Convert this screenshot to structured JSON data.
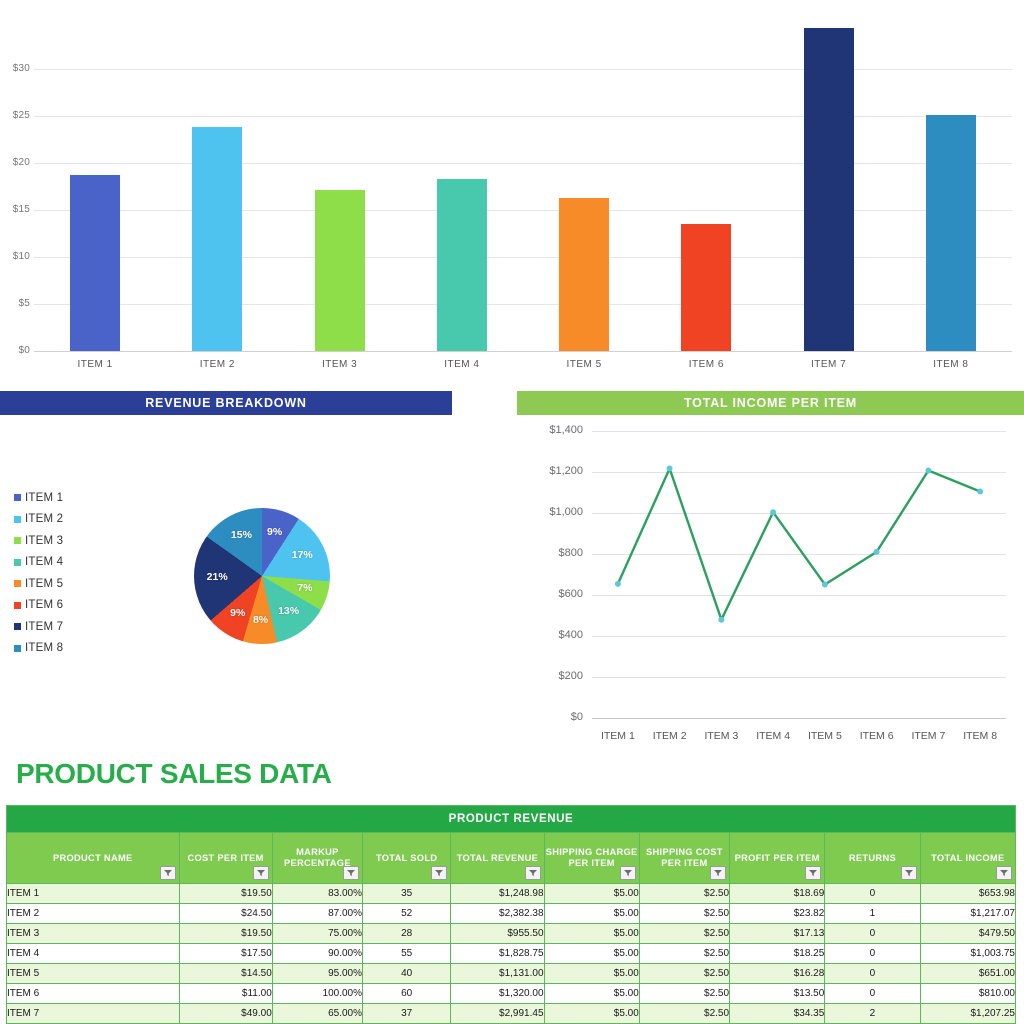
{
  "chart_data": [
    {
      "type": "bar",
      "title": "",
      "xlabel": "",
      "ylabel": "",
      "categories": [
        "ITEM 1",
        "ITEM 2",
        "ITEM 3",
        "ITEM 4",
        "ITEM 5",
        "ITEM 6",
        "ITEM 7",
        "ITEM 8"
      ],
      "values": [
        18.69,
        23.82,
        17.13,
        18.25,
        16.28,
        13.5,
        34.35,
        25.1
      ],
      "ylim": [
        0,
        35
      ],
      "ytick_labels": [
        "$0",
        "$5",
        "$10",
        "$15",
        "$20",
        "$25",
        "$30"
      ],
      "ytick_values": [
        0,
        5,
        10,
        15,
        20,
        25,
        30
      ],
      "grid": true,
      "legend": "none",
      "colors": [
        "#4a63c8",
        "#4ec3ef",
        "#8ede4a",
        "#48c9ae",
        "#f78b27",
        "#f04323",
        "#1f3575",
        "#2e8dc0"
      ]
    },
    {
      "type": "pie",
      "title": "REVENUE BREAKDOWN",
      "labels": [
        "ITEM 1",
        "ITEM 2",
        "ITEM 3",
        "ITEM 4",
        "ITEM 5",
        "ITEM 6",
        "ITEM 7",
        "ITEM 8"
      ],
      "values": [
        9,
        17,
        7,
        13,
        8,
        9,
        21,
        15
      ],
      "value_labels": [
        "9%",
        "17%",
        "7%",
        "13%",
        "8%",
        "9%",
        "21%",
        "15%"
      ],
      "legend": "left",
      "colors": [
        "#4a63c8",
        "#4ec3ef",
        "#8ede4a",
        "#48c9ae",
        "#f78b27",
        "#f04323",
        "#1f3575",
        "#2e8dc0"
      ]
    },
    {
      "type": "line",
      "title": "TOTAL INCOME PER ITEM",
      "xlabel": "",
      "ylabel": "",
      "categories": [
        "ITEM 1",
        "ITEM 2",
        "ITEM 3",
        "ITEM 4",
        "ITEM 5",
        "ITEM 6",
        "ITEM 7",
        "ITEM 8"
      ],
      "values": [
        653.98,
        1217.07,
        479.5,
        1003.75,
        651.0,
        810.0,
        1207.25,
        1105.0
      ],
      "ylim": [
        0,
        1400
      ],
      "ytick_labels": [
        "$0",
        "$200",
        "$400",
        "$600",
        "$800",
        "$1,000",
        "$1,200",
        "$1,400"
      ],
      "ytick_values": [
        0,
        200,
        400,
        600,
        800,
        1000,
        1200,
        1400
      ],
      "grid": true,
      "legend": "none",
      "line_color": "#2ba060",
      "marker_color": "#5ec8d8"
    }
  ],
  "pie_panel": {
    "banner": "REVENUE BREAKDOWN",
    "banner_color": "#2b3f99"
  },
  "line_panel": {
    "banner": "TOTAL INCOME PER ITEM",
    "banner_color": "#8dc953"
  },
  "sales_section": {
    "title": "PRODUCT SALES DATA",
    "title_color": "#27ae4a",
    "table": {
      "super_header": "PRODUCT REVENUE",
      "columns": [
        "PRODUCT NAME",
        "COST PER ITEM",
        "MARKUP PERCENTAGE",
        "TOTAL SOLD",
        "TOTAL REVENUE",
        "SHIPPING CHARGE PER ITEM",
        "SHIPPING COST PER ITEM",
        "PROFIT PER ITEM",
        "RETURNS",
        "TOTAL INCOME"
      ],
      "filter_icon": "filter-dropdown-icon",
      "rows": [
        [
          "ITEM 1",
          "$19.50",
          "83.00%",
          "35",
          "$1,248.98",
          "$5.00",
          "$2.50",
          "$18.69",
          "0",
          "$653.98"
        ],
        [
          "ITEM 2",
          "$24.50",
          "87.00%",
          "52",
          "$2,382.38",
          "$5.00",
          "$2.50",
          "$23.82",
          "1",
          "$1,217.07"
        ],
        [
          "ITEM 3",
          "$19.50",
          "75.00%",
          "28",
          "$955.50",
          "$5.00",
          "$2.50",
          "$17.13",
          "0",
          "$479.50"
        ],
        [
          "ITEM 4",
          "$17.50",
          "90.00%",
          "55",
          "$1,828.75",
          "$5.00",
          "$2.50",
          "$18.25",
          "0",
          "$1,003.75"
        ],
        [
          "ITEM 5",
          "$14.50",
          "95.00%",
          "40",
          "$1,131.00",
          "$5.00",
          "$2.50",
          "$16.28",
          "0",
          "$651.00"
        ],
        [
          "ITEM 6",
          "$11.00",
          "100.00%",
          "60",
          "$1,320.00",
          "$5.00",
          "$2.50",
          "$13.50",
          "0",
          "$810.00"
        ],
        [
          "ITEM 7",
          "$49.00",
          "65.00%",
          "37",
          "$2,991.45",
          "$5.00",
          "$2.50",
          "$34.35",
          "2",
          "$1,207.25"
        ]
      ]
    }
  }
}
